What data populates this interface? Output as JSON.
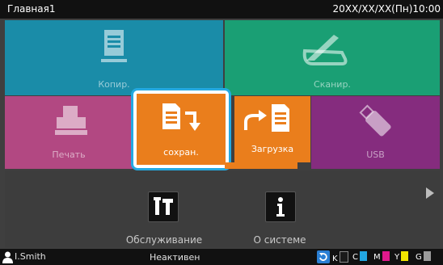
{
  "header": {
    "title": "Главная1",
    "datetime": "20XX/XX/XX(Пн)10:00"
  },
  "tiles": {
    "copy": {
      "label": "Копир.",
      "icon": "copy-document-icon",
      "color": "#1a8ca8"
    },
    "scan": {
      "label": "Сканир.",
      "icon": "scanner-icon",
      "color": "#1a9f74"
    },
    "print": {
      "label": "Печать",
      "icon": "printer-icon",
      "color": "#b24882"
    },
    "store": {
      "label": "сохран.",
      "icon": "store-document-icon",
      "color": "#ea7e1c",
      "selected": true
    },
    "load": {
      "label": "Загрузка",
      "icon": "load-document-icon",
      "color": "#ea7e1c"
    },
    "usb": {
      "label": "USB",
      "icon": "usb-icon",
      "color": "#852c7e"
    }
  },
  "tools": {
    "maintenance": {
      "label": "Обслуживание",
      "icon": "tools-icon"
    },
    "system": {
      "label": "О системе",
      "icon": "info-icon"
    }
  },
  "status": {
    "user": "I.Smith",
    "state": "Неактивен",
    "inks": [
      {
        "label": "K",
        "color": "#1a1a1a"
      },
      {
        "label": "C",
        "color": "#22a6e0"
      },
      {
        "label": "M",
        "color": "#e0198c"
      },
      {
        "label": "Y",
        "color": "#f2e600"
      },
      {
        "label": "G",
        "color": "#9a9a9a"
      }
    ]
  }
}
